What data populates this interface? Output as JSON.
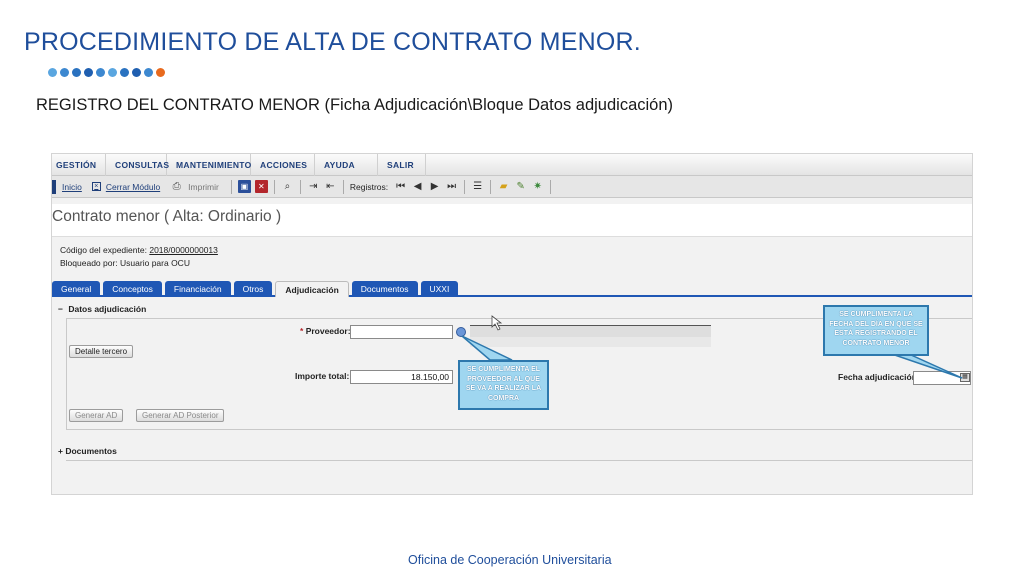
{
  "slide": {
    "title": "PROCEDIMIENTO DE ALTA DE CONTRATO MENOR.",
    "subtitle": "REGISTRO DEL CONTRATO MENOR (Ficha Adjudicación\\Bloque Datos adjudicación)",
    "footer": "Oficina de Cooperación Universitaria",
    "dot_colors": [
      "#5aa6e0",
      "#3d88d0",
      "#2a72c0",
      "#1f5fb0",
      "#3d88d0",
      "#5aa6e0",
      "#2a72c0",
      "#1f5fb0",
      "#3d88d0",
      "#e86a1e"
    ]
  },
  "menu": {
    "items": [
      "Gestión",
      "Consultas",
      "Mantenimiento",
      "Acciones",
      "Ayuda",
      "Salir"
    ]
  },
  "toolbar": {
    "inicio": "Inicio",
    "cerrar_modulo": "Cerrar Módulo",
    "imprimir": "Imprimir",
    "registros_label": "Registros:"
  },
  "form": {
    "title": "Contrato menor ( Alta: Ordinario )",
    "expediente_label": "Código del expediente:",
    "expediente_value": "2018/0000000013",
    "bloqueado_label": "Bloqueado por:",
    "bloqueado_value": "Usuario para OCU"
  },
  "tabs": [
    {
      "label": "General",
      "active": false
    },
    {
      "label": "Conceptos",
      "active": false
    },
    {
      "label": "Financiación",
      "active": false
    },
    {
      "label": "Otros",
      "active": false
    },
    {
      "label": "Adjudicación",
      "active": true
    },
    {
      "label": "Documentos",
      "active": false
    },
    {
      "label": "UXXI",
      "active": false
    }
  ],
  "datos_adjudicacion": {
    "section_sign": "−",
    "section_label": "Datos adjudicación",
    "proveedor_required_mark": "*",
    "proveedor_label": "Proveedor:",
    "proveedor_value": "",
    "detalle_tercero": "Detalle tercero",
    "importe_label": "Importe total:",
    "importe_value": "18.150,00",
    "fecha_label": "Fecha adjudicación:",
    "fecha_value": "",
    "generar_ad": "Generar AD",
    "generar_ad_posterior": "Generar AD Posterior"
  },
  "documentos_section": {
    "sign": "+",
    "label": "Documentos"
  },
  "callouts": {
    "proveedor": "SE CUMPLIMENTA EL PROVEEDOR AL QUE SE VA A REALIZAR LA COMPRA",
    "fecha": "SE CUMPLIMENTA LA FECHA DEL DÍA EN QUE SE ESTÁ REGISTRANDO EL CONTRATO MENOR"
  },
  "icons": {
    "inicio": "home-icon",
    "cerrar": "close-module-icon",
    "imprimir": "printer-icon",
    "guardar": "save-icon",
    "borrar": "delete-icon",
    "buscar": "magnifier-icon",
    "primero": "first-record-icon",
    "anterior": "previous-record-icon",
    "siguiente": "next-record-icon",
    "ultimo": "last-record-icon",
    "lista": "list-icon",
    "carpeta": "folder-icon",
    "editar": "edit-doc-icon",
    "config": "gear-icon",
    "proveedor_lookup": "lookup-icon",
    "calendario": "calendar-icon"
  }
}
